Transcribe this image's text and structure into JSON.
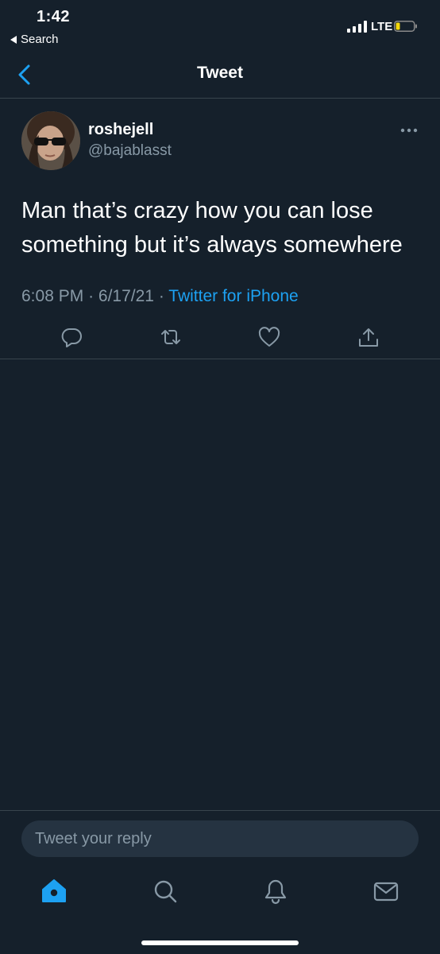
{
  "status_bar": {
    "time": "1:42",
    "back_app": "Search",
    "network": "LTE",
    "battery_color": "#f5d90a"
  },
  "nav": {
    "title": "Tweet",
    "accent": "#1da1f2"
  },
  "tweet": {
    "display_name": "roshejell",
    "handle": "@bajablasst",
    "text_line1": "Man that’s crazy how you can lose",
    "text_line2": "something but it’s always somewhere",
    "time": "6:08 PM",
    "separator": "·",
    "date": "6/17/21",
    "source": "Twitter for iPhone",
    "actions": [
      "reply-icon",
      "retweet-icon",
      "like-icon",
      "share-icon"
    ]
  },
  "reply": {
    "placeholder": "Tweet your reply"
  },
  "tab_bar": {
    "items": [
      "home-icon",
      "search-icon",
      "notifications-icon",
      "messages-icon"
    ],
    "active": "home-icon"
  },
  "colors": {
    "background": "#15202b",
    "secondary_text": "#8899a6",
    "divider": "#38444d",
    "link": "#1da1f2"
  }
}
